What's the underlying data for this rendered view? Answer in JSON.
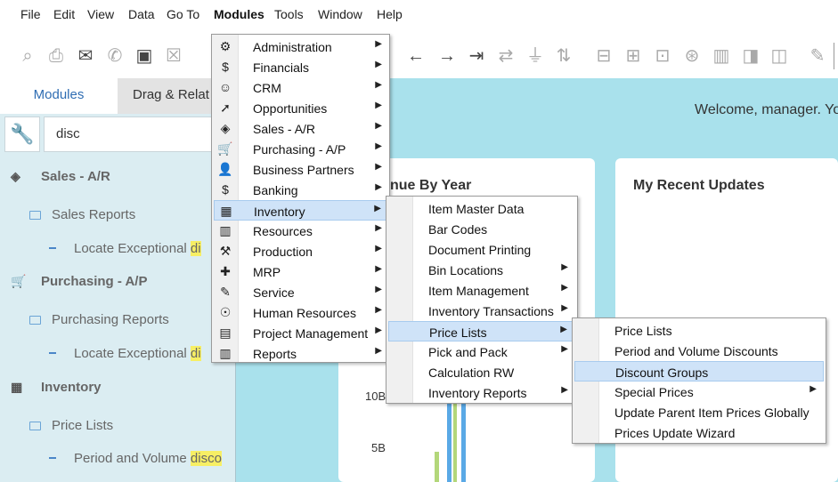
{
  "menubar": {
    "items": [
      "File",
      "Edit",
      "View",
      "Data",
      "Go To",
      "Modules",
      "Tools",
      "Window",
      "Help"
    ]
  },
  "left_panel": {
    "tabs": [
      "Modules",
      "Drag & Relat"
    ],
    "search_value": "disc",
    "tree": [
      {
        "label": "Sales - A/R",
        "icon": "sales-icon"
      },
      {
        "label": "Sales Reports"
      },
      {
        "label": "Locate Exceptional ",
        "highlight": "di"
      },
      {
        "label": "Purchasing - A/P",
        "icon": "cart-icon"
      },
      {
        "label": "Purchasing Reports"
      },
      {
        "label": "Locate Exceptional ",
        "highlight": "di"
      },
      {
        "label": "Inventory",
        "icon": "inventory-icon"
      },
      {
        "label": "Price Lists"
      },
      {
        "label": "Period and Volume ",
        "highlight": "disco"
      }
    ]
  },
  "content": {
    "welcome": "Welcome, manager. Yo",
    "revenue_title": "nue By Year",
    "recent_title": "My Recent Updates",
    "y_ticks": [
      "10B",
      "5B"
    ]
  },
  "modules_menu": [
    {
      "label": "Administration",
      "icon": "administration-icon",
      "ico": "⚙"
    },
    {
      "label": "Financials",
      "icon": "financials-icon",
      "ico": "$"
    },
    {
      "label": "CRM",
      "icon": "crm-icon",
      "ico": "☺"
    },
    {
      "label": "Opportunities",
      "icon": "opportunities-icon",
      "ico": "➚"
    },
    {
      "label": "Sales - A/R",
      "icon": "sales-icon",
      "ico": "◈"
    },
    {
      "label": "Purchasing - A/P",
      "icon": "cart-icon",
      "ico": "🛒"
    },
    {
      "label": "Business Partners",
      "icon": "person-icon",
      "ico": "👤"
    },
    {
      "label": "Banking",
      "icon": "banking-icon",
      "ico": "$"
    },
    {
      "label": "Inventory",
      "icon": "inventory-icon",
      "ico": "▦"
    },
    {
      "label": "Resources",
      "icon": "resources-icon",
      "ico": "▥"
    },
    {
      "label": "Production",
      "icon": "production-icon",
      "ico": "⚒"
    },
    {
      "label": "MRP",
      "icon": "mrp-icon",
      "ico": "✚"
    },
    {
      "label": "Service",
      "icon": "service-icon",
      "ico": "✎"
    },
    {
      "label": "Human Resources",
      "icon": "human-resources-icon",
      "ico": "☉"
    },
    {
      "label": "Project Management",
      "icon": "project-management-icon",
      "ico": "▤"
    },
    {
      "label": "Reports",
      "icon": "reports-icon",
      "ico": "▥"
    }
  ],
  "inventory_menu": [
    {
      "label": "Item Master Data",
      "submenu": false
    },
    {
      "label": "Bar Codes",
      "submenu": false
    },
    {
      "label": "Document Printing",
      "submenu": false
    },
    {
      "label": "Bin Locations",
      "submenu": true
    },
    {
      "label": "Item Management",
      "submenu": true
    },
    {
      "label": "Inventory Transactions",
      "submenu": true
    },
    {
      "label": "Price Lists",
      "submenu": true
    },
    {
      "label": "Pick and Pack",
      "submenu": true
    },
    {
      "label": "Calculation RW",
      "submenu": false
    },
    {
      "label": "Inventory Reports",
      "submenu": true
    }
  ],
  "pricelists_menu": [
    {
      "label": "Price Lists",
      "submenu": false
    },
    {
      "label": "Period and Volume Discounts",
      "submenu": false
    },
    {
      "label": "Discount Groups",
      "submenu": false
    },
    {
      "label": "Special Prices",
      "submenu": true
    },
    {
      "label": "Update Parent Item Prices Globally",
      "submenu": false
    },
    {
      "label": "Prices Update Wizard",
      "submenu": false
    }
  ],
  "colors": {
    "panel_bg": "#dbedf2",
    "content_bg": "#a9e1ec",
    "menu_hover": "#cfe3f8",
    "bar_blue": "#5aa9e6",
    "bar_green": "#b3d77a",
    "search_highlight": "#f7ef64"
  }
}
